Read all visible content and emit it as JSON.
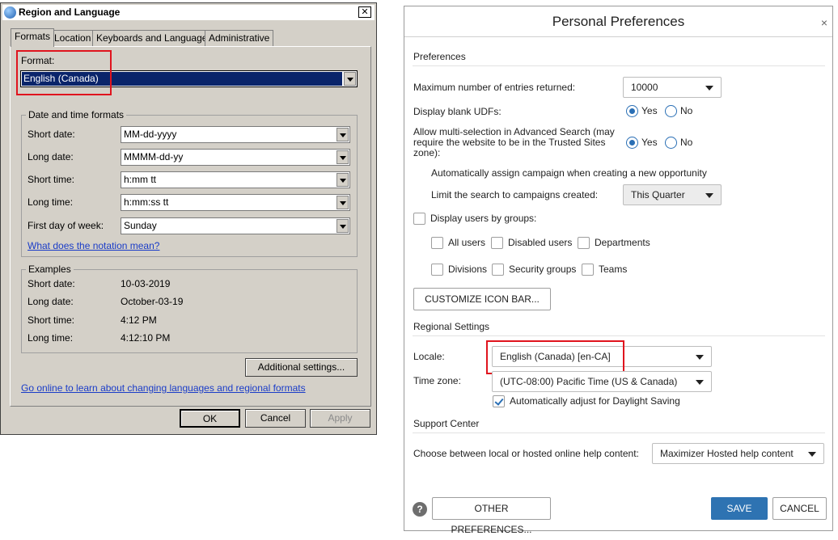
{
  "region_dialog": {
    "title": "Region and Language",
    "close_glyph": "✕",
    "tabs": [
      {
        "label": "Formats"
      },
      {
        "label": "Location"
      },
      {
        "label": "Keyboards and Languages"
      },
      {
        "label": "Administrative"
      }
    ],
    "format_label": "Format:",
    "format_value": "English (Canada)",
    "datetime_group": "Date and time formats",
    "fields": [
      {
        "label": "Short date:",
        "value": "MM-dd-yyyy"
      },
      {
        "label": "Long date:",
        "value": "MMMM-dd-yy"
      },
      {
        "label": "Short time:",
        "value": "h:mm tt"
      },
      {
        "label": "Long time:",
        "value": "h:mm:ss tt"
      },
      {
        "label": "First day of week:",
        "value": "Sunday"
      }
    ],
    "notation_link": "What does the notation mean?",
    "examples_group": "Examples",
    "examples": [
      {
        "label": "Short date:",
        "value": "10-03-2019"
      },
      {
        "label": "Long date:",
        "value": "October-03-19"
      },
      {
        "label": "Short time:",
        "value": "4:12 PM"
      },
      {
        "label": "Long time:",
        "value": "4:12:10 PM"
      }
    ],
    "additional_settings": "Additional settings...",
    "online_link": "Go online to learn about changing languages and regional formats",
    "ok": "OK",
    "cancel": "Cancel",
    "apply": "Apply"
  },
  "prefs_dialog": {
    "title": "Personal Preferences",
    "close_glyph": "×",
    "preferences_section": "Preferences",
    "max_entries_label": "Maximum number of entries returned:",
    "max_entries_value": "10000",
    "blank_udfs_label": "Display blank UDFs:",
    "yes": "Yes",
    "no": "No",
    "multisel_label": "Allow multi-selection in Advanced Search (may require the website to be in the Trusted Sites zone):",
    "auto_campaign": "Automatically assign campaign when creating a new opportunity",
    "limit_search_label": "Limit the search to campaigns created:",
    "limit_search_value": "This Quarter",
    "display_users_groups": "Display users by groups:",
    "groups": [
      "All users",
      "Disabled users",
      "Departments",
      "Divisions",
      "Security groups",
      "Teams"
    ],
    "customize_icon_bar": "CUSTOMIZE ICON BAR...",
    "regional_section": "Regional Settings",
    "locale_label": "Locale:",
    "locale_value": "English (Canada) [en-CA]",
    "timezone_label": "Time zone:",
    "timezone_value": "(UTC-08:00) Pacific Time (US & Canada)",
    "dst_label": "Automatically adjust for Daylight Saving",
    "support_section": "Support Center",
    "help_content_label": "Choose between local or hosted online help content:",
    "help_content_value": "Maximizer Hosted help content",
    "help_glyph": "?",
    "other_preferences": "OTHER PREFERENCES...",
    "save": "SAVE",
    "cancel": "CANCEL"
  },
  "colors": {
    "highlight_box": "#e0141e",
    "selected_bg": "#0a246a",
    "primary_button": "#2e73b2",
    "link": "#1a3cc8"
  }
}
